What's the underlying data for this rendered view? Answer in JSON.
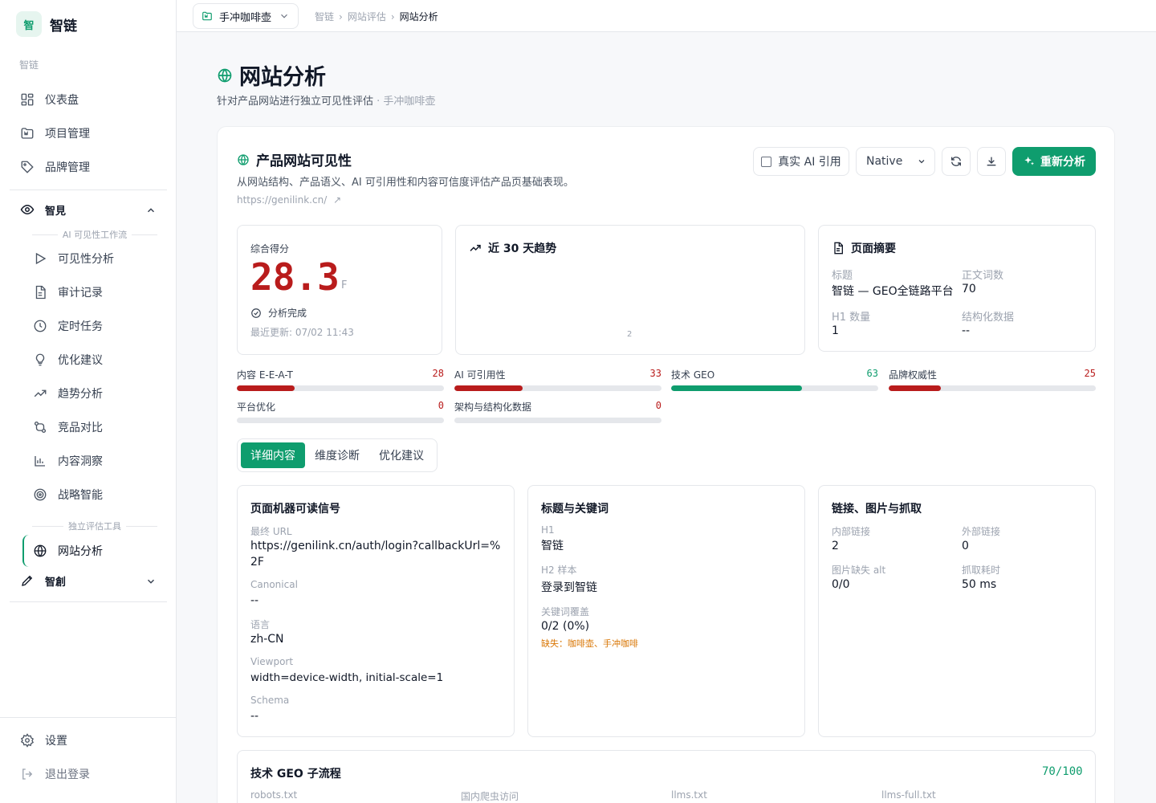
{
  "brand": {
    "logo_char": "智",
    "name": "智链"
  },
  "sidebar": {
    "section_label": "智链",
    "top_items": [
      {
        "label": "仪表盘",
        "icon": "dashboard-icon"
      },
      {
        "label": "项目管理",
        "icon": "folder-icon"
      },
      {
        "label": "品牌管理",
        "icon": "tag-icon"
      }
    ],
    "group_zhijian": {
      "label": "智見",
      "icon": "eye-icon"
    },
    "workflow_caption": "AI 可见性工作流",
    "workflow_items": [
      {
        "label": "可见性分析",
        "icon": "play-icon"
      },
      {
        "label": "审计记录",
        "icon": "document-icon"
      },
      {
        "label": "定时任务",
        "icon": "clock-icon"
      },
      {
        "label": "优化建议",
        "icon": "lightbulb-icon"
      },
      {
        "label": "趋势分析",
        "icon": "trend-icon"
      },
      {
        "label": "竞品对比",
        "icon": "compare-icon"
      },
      {
        "label": "内容洞察",
        "icon": "bar-chart-icon"
      },
      {
        "label": "战略智能",
        "icon": "target-icon"
      }
    ],
    "tools_caption": "独立评估工具",
    "active_item": {
      "label": "网站分析",
      "icon": "globe-icon"
    },
    "group_zhichuang": {
      "label": "智創",
      "icon": "pen-icon"
    },
    "settings": "设置",
    "logout": "退出登录"
  },
  "topbar": {
    "project": "手冲咖啡壶",
    "breadcrumb": [
      "智链",
      "网站评估",
      "网站分析"
    ]
  },
  "header": {
    "title": "网站分析",
    "subtitle": "针对产品网站进行独立可见性评估",
    "subtitle_sep": " · ",
    "subtitle_project": "手冲咖啡壶"
  },
  "card": {
    "title": "产品网站可见性",
    "description": "从网站结构、产品语义、AI 可引用性和内容可信度评估产品页基础表现。",
    "url": "https://genilink.cn/",
    "real_ai_label": "真实 AI 引用",
    "mode_value": "Native",
    "reanalyze_label": "重新分析"
  },
  "score_panel": {
    "label": "综合得分",
    "score": "28.3",
    "grade": "F",
    "status": "分析完成",
    "updated_label": "最近更新: 07/02 11:43"
  },
  "trend_panel": {
    "title": "近 30 天趋势",
    "point_label": "2"
  },
  "summary_panel": {
    "title": "页面摘要",
    "fields": [
      {
        "label": "标题",
        "value": "智链 — GEO全链路平台"
      },
      {
        "label": "正文词数",
        "value": "70"
      },
      {
        "label": "H1 数量",
        "value": "1"
      },
      {
        "label": "结构化数据",
        "value": "--"
      }
    ]
  },
  "metrics": [
    {
      "label": "内容 E-E-A-T",
      "value": 28,
      "color": "#b91c1c"
    },
    {
      "label": "AI 可引用性",
      "value": 33,
      "color": "#b91c1c"
    },
    {
      "label": "技术 GEO",
      "value": 63,
      "color": "#0f9d6e"
    },
    {
      "label": "品牌权威性",
      "value": 25,
      "color": "#b91c1c"
    },
    {
      "label": "平台优化",
      "value": 0,
      "color": "#b91c1c"
    },
    {
      "label": "架构与结构化数据",
      "value": 0,
      "color": "#b91c1c"
    }
  ],
  "tabs": [
    {
      "label": "详细内容",
      "active": true
    },
    {
      "label": "维度诊断",
      "active": false
    },
    {
      "label": "优化建议",
      "active": false
    }
  ],
  "machine_panel": {
    "title": "页面机器可读信号",
    "fields": [
      {
        "label": "最终 URL",
        "value": "https://genilink.cn/auth/login?callbackUrl=%2F"
      },
      {
        "label": "Canonical",
        "value": "--"
      },
      {
        "label": "语言",
        "value": "zh-CN"
      },
      {
        "label": "Viewport",
        "value": "width=device-width, initial-scale=1"
      },
      {
        "label": "Schema",
        "value": "--"
      }
    ]
  },
  "keyword_panel": {
    "title": "标题与关键词",
    "fields": [
      {
        "label": "H1",
        "value": "智链"
      },
      {
        "label": "H2 样本",
        "value": "登录到智链"
      },
      {
        "label": "关键词覆盖",
        "value": "0/2 (0%)"
      }
    ],
    "missing": "缺失：咖啡壶、手冲咖啡"
  },
  "links_panel": {
    "title": "链接、图片与抓取",
    "fields": [
      {
        "label": "内部链接",
        "value": "2"
      },
      {
        "label": "外部链接",
        "value": "0"
      },
      {
        "label": "图片缺失 alt",
        "value": "0/0"
      },
      {
        "label": "抓取耗时",
        "value": "50 ms"
      }
    ]
  },
  "tech_panel": {
    "title": "技术 GEO 子流程",
    "score": "70/100",
    "columns": [
      "robots.txt",
      "国内爬虫访问",
      "llms.txt",
      "llms-full.txt"
    ]
  },
  "colors": {
    "accent": "#0f9d6e",
    "danger": "#b91c1c",
    "warning": "#d97706"
  }
}
